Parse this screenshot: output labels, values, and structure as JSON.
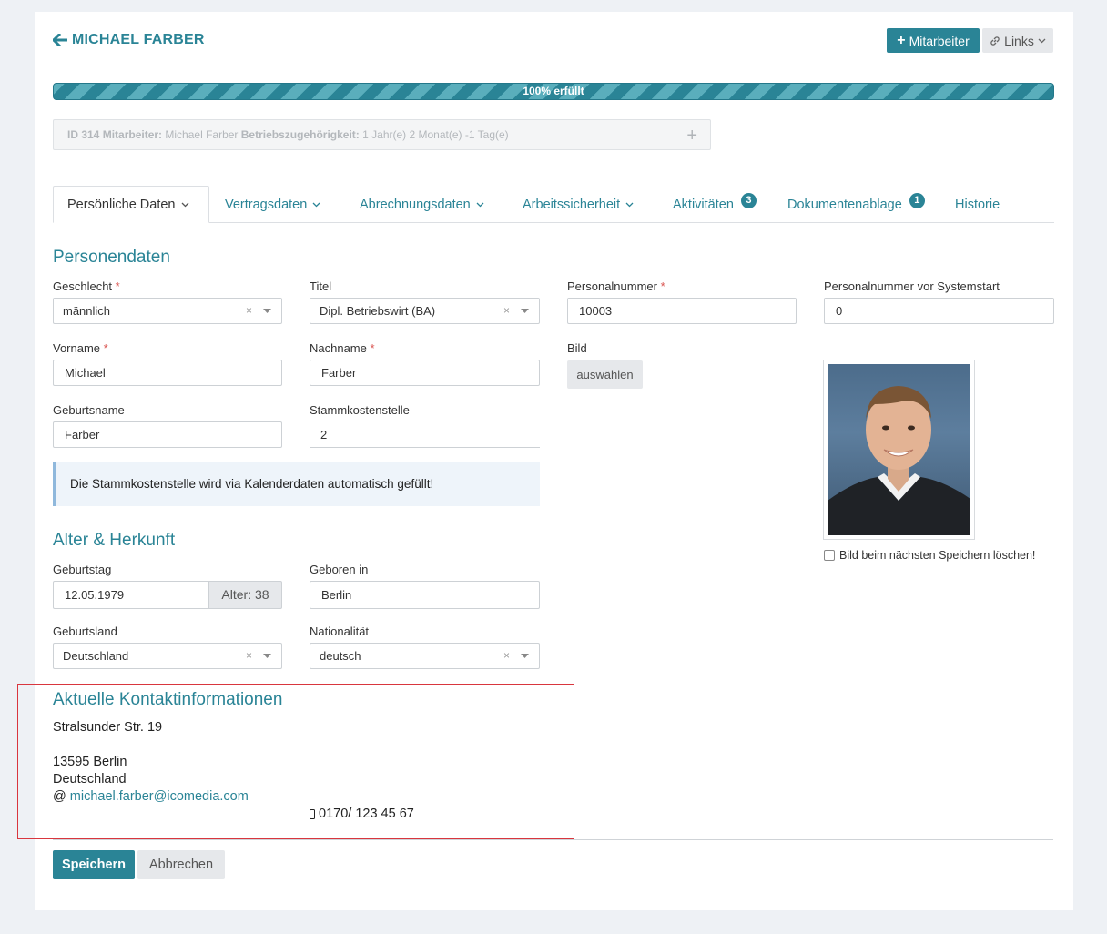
{
  "header": {
    "title": "MICHAEL FARBER",
    "add_button": "Mitarbeiter",
    "links_button": "Links"
  },
  "progress": {
    "label": "100% erfüllt",
    "percent": 100
  },
  "infobox": {
    "id": "ID 314",
    "employee_label": "Mitarbeiter:",
    "employee_value": "Michael Farber",
    "tenure_label": "Betriebszugehörigkeit:",
    "tenure_value": "1 Jahr(e) 2 Monat(e) -1 Tag(e)"
  },
  "tabs": [
    {
      "label": "Persönliche Daten"
    },
    {
      "label": "Vertragsdaten"
    },
    {
      "label": "Abrechnungsdaten"
    },
    {
      "label": "Arbeitssicherheit"
    },
    {
      "label": "Aktivitäten",
      "badge": "3"
    },
    {
      "label": "Dokumentenablage",
      "badge": "1"
    },
    {
      "label": "Historie"
    }
  ],
  "personendaten": {
    "title": "Personendaten",
    "geschlecht": {
      "label": "Geschlecht",
      "value": "männlich"
    },
    "titel": {
      "label": "Titel",
      "value": "Dipl. Betriebswirt (BA)"
    },
    "personalnummer": {
      "label": "Personalnummer",
      "value": "10003"
    },
    "personalnummer_vor": {
      "label": "Personalnummer vor Systemstart",
      "value": "0"
    },
    "vorname": {
      "label": "Vorname",
      "value": "Michael"
    },
    "nachname": {
      "label": "Nachname",
      "value": "Farber"
    },
    "bild": {
      "label": "Bild",
      "button": "auswählen"
    },
    "geburtsname": {
      "label": "Geburtsname",
      "value": "Farber"
    },
    "stammkostenstelle": {
      "label": "Stammkostenstelle",
      "value": "2"
    },
    "hint": "Die Stammkostenstelle wird via Kalenderdaten automatisch gefüllt!",
    "delete_image": "Bild beim nächsten Speichern löschen!",
    "required_mark": "*",
    "clear_mark": "×"
  },
  "herkunft": {
    "title": "Alter & Herkunft",
    "geburtstag": {
      "label": "Geburtstag",
      "value": "12.05.1979",
      "addon": "Alter: 38"
    },
    "geboren_in": {
      "label": "Geboren in",
      "value": "Berlin"
    },
    "geburtsland": {
      "label": "Geburtsland",
      "value": "Deutschland"
    },
    "nationalitaet": {
      "label": "Nationalität",
      "value": "deutsch"
    }
  },
  "kontakt": {
    "title": "Aktuelle Kontaktinformationen",
    "street": "Stralsunder Str. 19",
    "city": "13595 Berlin",
    "country": "Deutschland",
    "email_prefix": "@",
    "email": "michael.farber@icomedia.com",
    "phone": "0170/ 123 45 67"
  },
  "footer": {
    "save": "Speichern",
    "cancel": "Abbrechen"
  },
  "colors": {
    "accent": "#2a8496",
    "required": "#d9534f",
    "highlight_border": "#d9363e"
  }
}
